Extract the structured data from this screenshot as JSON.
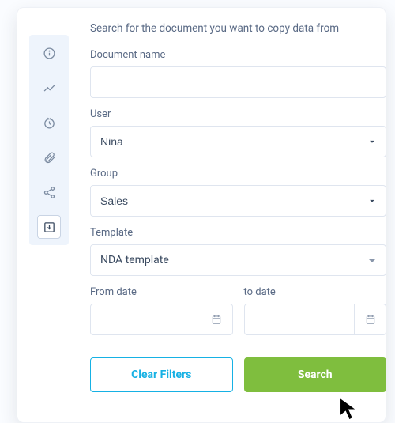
{
  "heading": "Search for the document you want to copy data from",
  "sidebar": {
    "icons": [
      "info",
      "activity",
      "clock",
      "attachment",
      "share",
      "download-box"
    ]
  },
  "form": {
    "doc_name": {
      "label": "Document name",
      "value": ""
    },
    "user": {
      "label": "User",
      "value": "Nina"
    },
    "group": {
      "label": "Group",
      "value": "Sales"
    },
    "template": {
      "label": "Template",
      "value": "NDA template"
    },
    "from_date": {
      "label": "From date",
      "value": ""
    },
    "to_date": {
      "label": "to date",
      "value": ""
    }
  },
  "buttons": {
    "clear": "Clear Filters",
    "search": "Search"
  },
  "colors": {
    "accent_blue": "#16b1e4",
    "accent_green": "#7fbe3e",
    "sidebar_bg": "#eef4fc"
  }
}
